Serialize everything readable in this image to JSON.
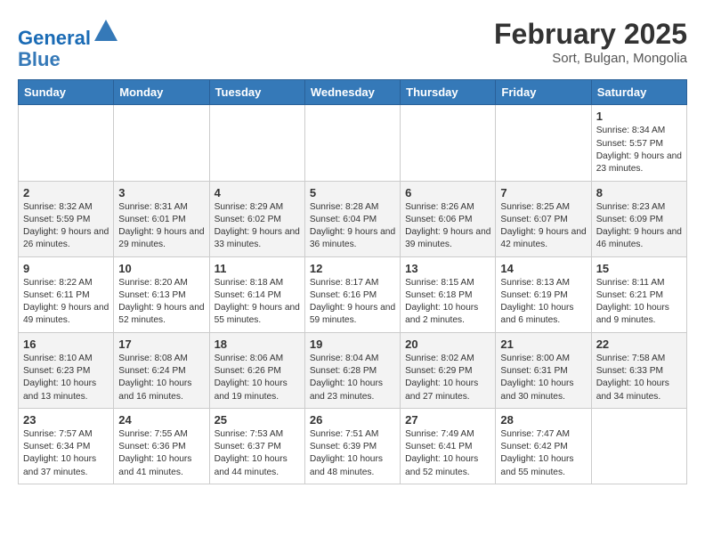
{
  "header": {
    "logo_line1": "General",
    "logo_line2": "Blue",
    "month_title": "February 2025",
    "subtitle": "Sort, Bulgan, Mongolia"
  },
  "days_of_week": [
    "Sunday",
    "Monday",
    "Tuesday",
    "Wednesday",
    "Thursday",
    "Friday",
    "Saturday"
  ],
  "weeks": [
    [
      {
        "day": "",
        "info": ""
      },
      {
        "day": "",
        "info": ""
      },
      {
        "day": "",
        "info": ""
      },
      {
        "day": "",
        "info": ""
      },
      {
        "day": "",
        "info": ""
      },
      {
        "day": "",
        "info": ""
      },
      {
        "day": "1",
        "info": "Sunrise: 8:34 AM\nSunset: 5:57 PM\nDaylight: 9 hours and 23 minutes."
      }
    ],
    [
      {
        "day": "2",
        "info": "Sunrise: 8:32 AM\nSunset: 5:59 PM\nDaylight: 9 hours and 26 minutes."
      },
      {
        "day": "3",
        "info": "Sunrise: 8:31 AM\nSunset: 6:01 PM\nDaylight: 9 hours and 29 minutes."
      },
      {
        "day": "4",
        "info": "Sunrise: 8:29 AM\nSunset: 6:02 PM\nDaylight: 9 hours and 33 minutes."
      },
      {
        "day": "5",
        "info": "Sunrise: 8:28 AM\nSunset: 6:04 PM\nDaylight: 9 hours and 36 minutes."
      },
      {
        "day": "6",
        "info": "Sunrise: 8:26 AM\nSunset: 6:06 PM\nDaylight: 9 hours and 39 minutes."
      },
      {
        "day": "7",
        "info": "Sunrise: 8:25 AM\nSunset: 6:07 PM\nDaylight: 9 hours and 42 minutes."
      },
      {
        "day": "8",
        "info": "Sunrise: 8:23 AM\nSunset: 6:09 PM\nDaylight: 9 hours and 46 minutes."
      }
    ],
    [
      {
        "day": "9",
        "info": "Sunrise: 8:22 AM\nSunset: 6:11 PM\nDaylight: 9 hours and 49 minutes."
      },
      {
        "day": "10",
        "info": "Sunrise: 8:20 AM\nSunset: 6:13 PM\nDaylight: 9 hours and 52 minutes."
      },
      {
        "day": "11",
        "info": "Sunrise: 8:18 AM\nSunset: 6:14 PM\nDaylight: 9 hours and 55 minutes."
      },
      {
        "day": "12",
        "info": "Sunrise: 8:17 AM\nSunset: 6:16 PM\nDaylight: 9 hours and 59 minutes."
      },
      {
        "day": "13",
        "info": "Sunrise: 8:15 AM\nSunset: 6:18 PM\nDaylight: 10 hours and 2 minutes."
      },
      {
        "day": "14",
        "info": "Sunrise: 8:13 AM\nSunset: 6:19 PM\nDaylight: 10 hours and 6 minutes."
      },
      {
        "day": "15",
        "info": "Sunrise: 8:11 AM\nSunset: 6:21 PM\nDaylight: 10 hours and 9 minutes."
      }
    ],
    [
      {
        "day": "16",
        "info": "Sunrise: 8:10 AM\nSunset: 6:23 PM\nDaylight: 10 hours and 13 minutes."
      },
      {
        "day": "17",
        "info": "Sunrise: 8:08 AM\nSunset: 6:24 PM\nDaylight: 10 hours and 16 minutes."
      },
      {
        "day": "18",
        "info": "Sunrise: 8:06 AM\nSunset: 6:26 PM\nDaylight: 10 hours and 19 minutes."
      },
      {
        "day": "19",
        "info": "Sunrise: 8:04 AM\nSunset: 6:28 PM\nDaylight: 10 hours and 23 minutes."
      },
      {
        "day": "20",
        "info": "Sunrise: 8:02 AM\nSunset: 6:29 PM\nDaylight: 10 hours and 27 minutes."
      },
      {
        "day": "21",
        "info": "Sunrise: 8:00 AM\nSunset: 6:31 PM\nDaylight: 10 hours and 30 minutes."
      },
      {
        "day": "22",
        "info": "Sunrise: 7:58 AM\nSunset: 6:33 PM\nDaylight: 10 hours and 34 minutes."
      }
    ],
    [
      {
        "day": "23",
        "info": "Sunrise: 7:57 AM\nSunset: 6:34 PM\nDaylight: 10 hours and 37 minutes."
      },
      {
        "day": "24",
        "info": "Sunrise: 7:55 AM\nSunset: 6:36 PM\nDaylight: 10 hours and 41 minutes."
      },
      {
        "day": "25",
        "info": "Sunrise: 7:53 AM\nSunset: 6:37 PM\nDaylight: 10 hours and 44 minutes."
      },
      {
        "day": "26",
        "info": "Sunrise: 7:51 AM\nSunset: 6:39 PM\nDaylight: 10 hours and 48 minutes."
      },
      {
        "day": "27",
        "info": "Sunrise: 7:49 AM\nSunset: 6:41 PM\nDaylight: 10 hours and 52 minutes."
      },
      {
        "day": "28",
        "info": "Sunrise: 7:47 AM\nSunset: 6:42 PM\nDaylight: 10 hours and 55 minutes."
      },
      {
        "day": "",
        "info": ""
      }
    ]
  ]
}
